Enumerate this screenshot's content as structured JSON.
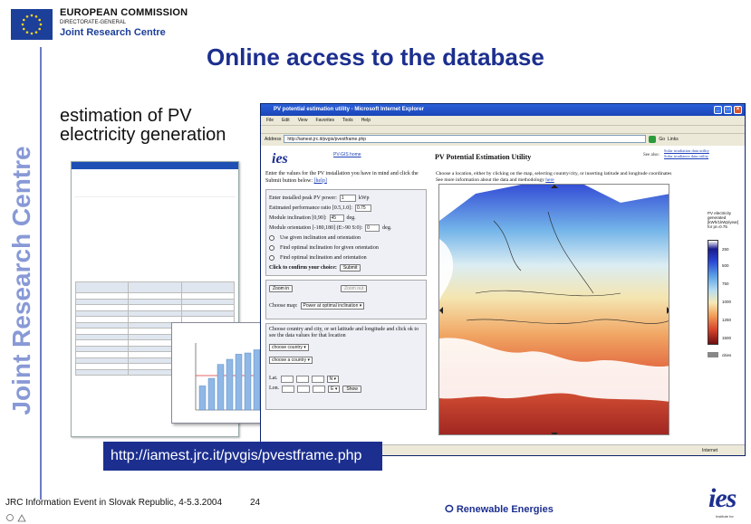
{
  "header": {
    "org": "EUROPEAN COMMISSION",
    "directorate": "DIRECTORATE-GENERAL",
    "centre": "Joint Research Centre",
    "slide_title": "Online access to the database"
  },
  "sidebar": {
    "vertical_text": "Joint Research Centre"
  },
  "caption": {
    "line1": "estimation of PV",
    "line2": "electricity generation"
  },
  "browser": {
    "title": "PV potential estimation utility - Microsoft Internet Explorer",
    "menu": [
      "File",
      "Edit",
      "View",
      "Favorites",
      "Tools",
      "Help"
    ],
    "address_label": "Address",
    "address_value": "http://iamest.jrc.it/pvgis/pvestframe.php",
    "go_label": "Go",
    "links_label": "Links",
    "status_zone": "Internet",
    "page": {
      "logo": "ies",
      "home_link": "PV-GIS home",
      "util_title": "PV Potential Estimation Utility",
      "see_also": "See also:",
      "see_links": [
        "Solar irradiation data utility",
        "Solar irradiance data utility"
      ],
      "intro": "Enter the values for the PV installation you have in mind and click the Submit button below:",
      "help": "[help]",
      "form": {
        "peak_power_label": "Enter installed peak PV power:",
        "peak_power_value": "1",
        "peak_power_unit": "kWp",
        "perf_ratio_label": "Estimated performance ratio [0.5,1.0]:",
        "perf_ratio_value": "0.75",
        "inclination_label": "Module inclination [0,90]:",
        "inclination_value": "45",
        "inclination_unit": "deg.",
        "orientation_label": "Module orientation [-180,180] (E:-90 S:0):",
        "orientation_value": "0",
        "orientation_unit": "deg.",
        "radio_options": [
          "Use given inclination and orientation",
          "Find optimal inclination for given orientation",
          "Find optimal inclination and orientation"
        ],
        "confirm_label": "Click to confirm your choice:",
        "submit_label": "Submit"
      },
      "zoom": {
        "zoom_in": "Zoom in",
        "zoom_out": "Zoom out",
        "choose_map": "Choose map:",
        "map_option": "Power at optimal inclination"
      },
      "location": {
        "text": "Choose country and city, or set latitude and longitude and click ok to see the data values for that location",
        "country_select": "choose country",
        "city_select": "choose a country",
        "lat_label": "Lat.",
        "lon_label": "Lon.",
        "show_label": "Show"
      },
      "right_intro": "Choose a location, either by clicking on the map, selecting country/city, or inserting latitude and longitude coordinates",
      "right_more": "See more information about the data and methodology",
      "here_link": "here",
      "legend": {
        "title": "PV electricity generated [kWh/1kWp/year] for pr=0.75",
        "ticks": [
          "250",
          "500",
          "750",
          "1000",
          "1250",
          "1500"
        ],
        "cities": "cities"
      }
    }
  },
  "url_box": "http://iamest.jrc.it/pvgis/pvestframe.php",
  "footer": {
    "event": "JRC Information Event in Slovak Republic, 4-5.3.2004",
    "page": "24",
    "program": "Renewable Energies",
    "ies": "ies",
    "ies_sub": "Institute for"
  },
  "colors": {
    "brand_blue": "#1c2f8f",
    "vertical_text": "#8899d6",
    "url_box": "#1c2f8f"
  }
}
